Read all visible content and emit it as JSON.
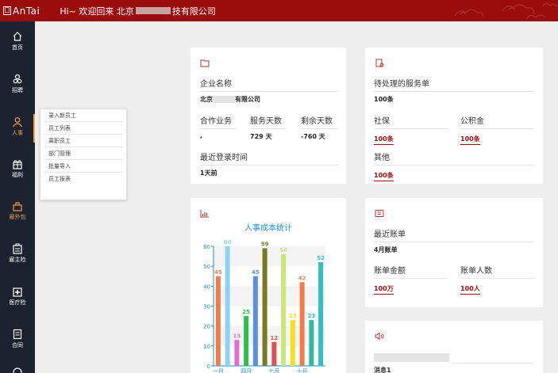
{
  "header": {
    "logo_text": "AnTai",
    "welcome_prefix": "Hi~ 欢迎回来 北京",
    "welcome_suffix": "技有限公司"
  },
  "sidebar": {
    "items": [
      {
        "label": "首页",
        "icon": "home-icon"
      },
      {
        "label": "招聘",
        "icon": "recruit-icon"
      },
      {
        "label": "人事",
        "icon": "person-icon",
        "active": true
      },
      {
        "label": "福利",
        "icon": "gift-icon"
      },
      {
        "label": "雇外包",
        "icon": "outsourcing-icon"
      },
      {
        "label": "雇主险",
        "icon": "employer-insurance-icon"
      },
      {
        "label": "医疗险",
        "icon": "medical-icon"
      },
      {
        "label": "合同",
        "icon": "contract-icon"
      }
    ]
  },
  "flyout": {
    "items": [
      "录入新员工",
      "员工列表",
      "离职员工",
      "部门管理",
      "批量导入",
      "员工报表"
    ]
  },
  "company_card": {
    "name_label": "企业名称",
    "name_prefix": "北京",
    "name_suffix": "有限公司",
    "coop_label": "合作业务",
    "coop_value": ",",
    "service_days_label": "服务天数",
    "service_days_value": "729 天",
    "remaining_days_label": "剩余天数",
    "remaining_days_value": "-760 天",
    "last_login_label": "最近登录时间",
    "last_login_value": "1天前"
  },
  "service_card": {
    "pending_label": "待处理的服务单",
    "pending_value": "100条",
    "social_label": "社保",
    "social_value": "100条",
    "fund_label": "公积金",
    "fund_value": "100条",
    "other_label": "其他",
    "other_value": "100条"
  },
  "bill_card": {
    "recent_label": "最近账单",
    "recent_value": "4月账单",
    "amount_label": "账单金额",
    "amount_value": "100万",
    "people_label": "账单人数",
    "people_value": "100人"
  },
  "message_card": {
    "message_label": "消息1"
  },
  "chart_data": {
    "type": "bar",
    "title": "人事成本统计",
    "ylim": [
      0,
      60
    ],
    "yticks": [
      0,
      10,
      20,
      30,
      40,
      50,
      60
    ],
    "xticks": [
      "一月",
      "四月",
      "七月",
      "十月"
    ],
    "values": [
      45,
      60,
      13,
      25,
      45,
      59,
      12,
      56,
      23,
      42,
      23,
      52
    ],
    "colors": [
      "#f07c4a",
      "#8fd0f5",
      "#e070c8",
      "#2cc04a",
      "#5a8ee8",
      "#7a7a20",
      "#e05050",
      "#c8e67a",
      "#f5e020",
      "#f07c4a",
      "#30b8a0",
      "#30c0c0"
    ]
  }
}
